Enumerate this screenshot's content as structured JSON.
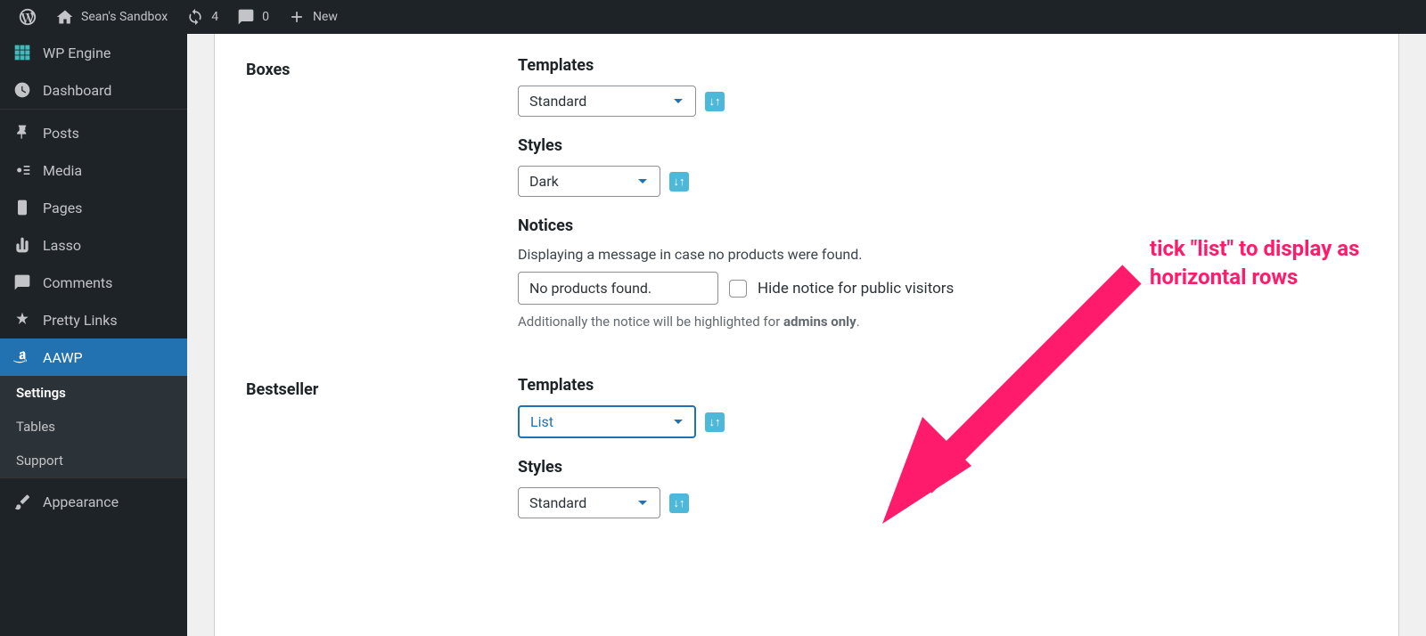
{
  "topbar": {
    "site_name": "Sean's Sandbox",
    "updates_count": "4",
    "comments_count": "0",
    "new_label": "New"
  },
  "sidebar": {
    "items": [
      {
        "label": "WP Engine",
        "icon": "grid"
      },
      {
        "label": "Dashboard",
        "icon": "gauge"
      },
      {
        "label": "Posts",
        "icon": "pin"
      },
      {
        "label": "Media",
        "icon": "media"
      },
      {
        "label": "Pages",
        "icon": "pages"
      },
      {
        "label": "Lasso",
        "icon": "cactus"
      },
      {
        "label": "Comments",
        "icon": "comment"
      },
      {
        "label": "Pretty Links",
        "icon": "star-link"
      },
      {
        "label": "AAWP",
        "icon": "amazon"
      },
      {
        "label": "Appearance",
        "icon": "brush"
      }
    ],
    "sub_items": [
      {
        "label": "Settings"
      },
      {
        "label": "Tables"
      },
      {
        "label": "Support"
      }
    ]
  },
  "sections": {
    "boxes": {
      "title": "Boxes",
      "templates_label": "Templates",
      "templates_value": "Standard",
      "styles_label": "Styles",
      "styles_value": "Dark",
      "notices_label": "Notices",
      "notices_desc": "Displaying a message in case no products were found.",
      "notices_value": "No products found.",
      "hide_notice_label": "Hide notice for public visitors",
      "notices_hint_pre": "Additionally the notice will be highlighted for ",
      "notices_hint_bold": "admins only",
      "notices_hint_post": "."
    },
    "bestseller": {
      "title": "Bestseller",
      "templates_label": "Templates",
      "templates_value": "List",
      "styles_label": "Styles",
      "styles_value": "Standard"
    }
  },
  "annotation": {
    "text": "tick \"list\" to display as horizontal rows"
  }
}
